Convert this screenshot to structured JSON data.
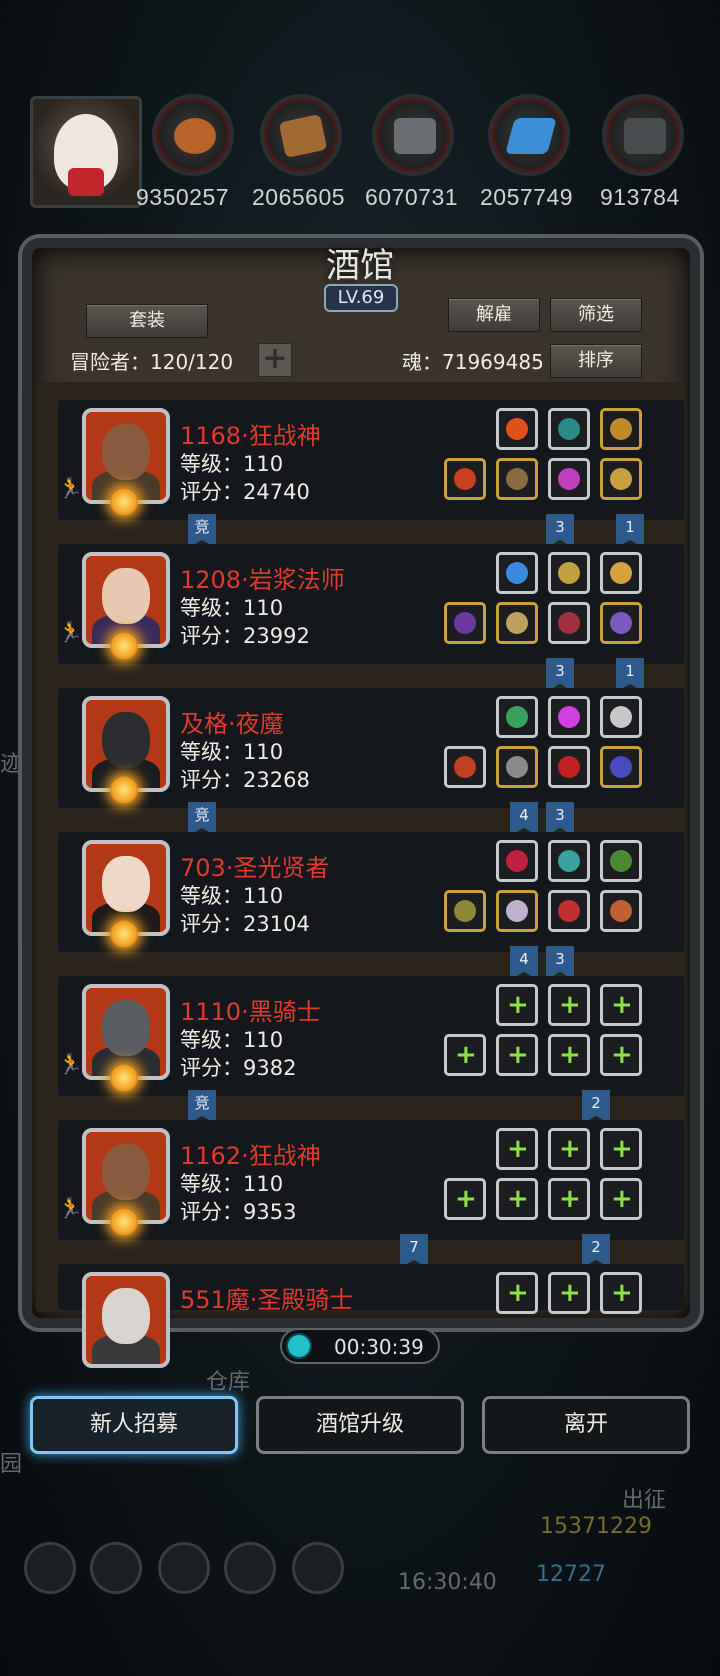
{
  "resources": [
    {
      "icon": "orb-icon",
      "value": "9350257",
      "color": "#b8642a"
    },
    {
      "icon": "wood-icon",
      "value": "2065605",
      "color": "#a06a35"
    },
    {
      "icon": "iron-icon",
      "value": "6070731",
      "color": "#6a6e72"
    },
    {
      "icon": "crystal-icon",
      "value": "2057749",
      "color": "#3c8ed6"
    },
    {
      "icon": "ore-icon",
      "value": "913784",
      "color": "#4a4d50"
    }
  ],
  "panel": {
    "title": "酒馆",
    "level": "LV.69",
    "suit_label": "套装",
    "dismiss_label": "解雇",
    "filter_label": "筛选",
    "sort_label": "排序",
    "adventurer_label": "冒险者：120/120",
    "soul_label": "魂：71969485"
  },
  "heroes": [
    {
      "name": "1168·狂战神",
      "level": "等级：110",
      "score": "评分：24740",
      "skin": "#8a5a3e",
      "cloth": "#4a3a2a"
    },
    {
      "name": "1208·岩浆法师",
      "level": "等级：110",
      "score": "评分：23992",
      "skin": "#e8c8b0",
      "cloth": "#3a2a5a"
    },
    {
      "name": "及格·夜魔",
      "level": "等级：110",
      "score": "评分：23268",
      "skin": "#2a2c30",
      "cloth": "#1a1c20"
    },
    {
      "name": "703·圣光贤者",
      "level": "等级：110",
      "score": "评分：23104",
      "skin": "#f0d8c8",
      "cloth": "#1e1a1a"
    },
    {
      "name": "1110·黑骑士",
      "level": "等级：110",
      "score": "评分：9382",
      "skin": "#5a5e62",
      "cloth": "#2a2c30"
    },
    {
      "name": "1162·狂战神",
      "level": "等级：110",
      "score": "评分：9353",
      "skin": "#8a5a3e",
      "cloth": "#4a3a2a"
    },
    {
      "name": "551魔·圣殿骑士",
      "level": "",
      "score": "",
      "skin": "#d8d4d0",
      "cloth": "#3a3a3a"
    }
  ],
  "tags": {
    "jing": "竞",
    "t1": "1",
    "t2": "2",
    "t3": "3",
    "t4": "4",
    "t7": "7"
  },
  "timer": "00:30:39",
  "buttons": {
    "recruit": "新人招募",
    "upgrade": "酒馆升级",
    "leave": "离开"
  },
  "background": {
    "warehouse": "仓库",
    "expedition": "出征",
    "gold": "15371229",
    "gems": "12727",
    "clock": "16:30:40",
    "left1": "迹",
    "left2": "园"
  }
}
